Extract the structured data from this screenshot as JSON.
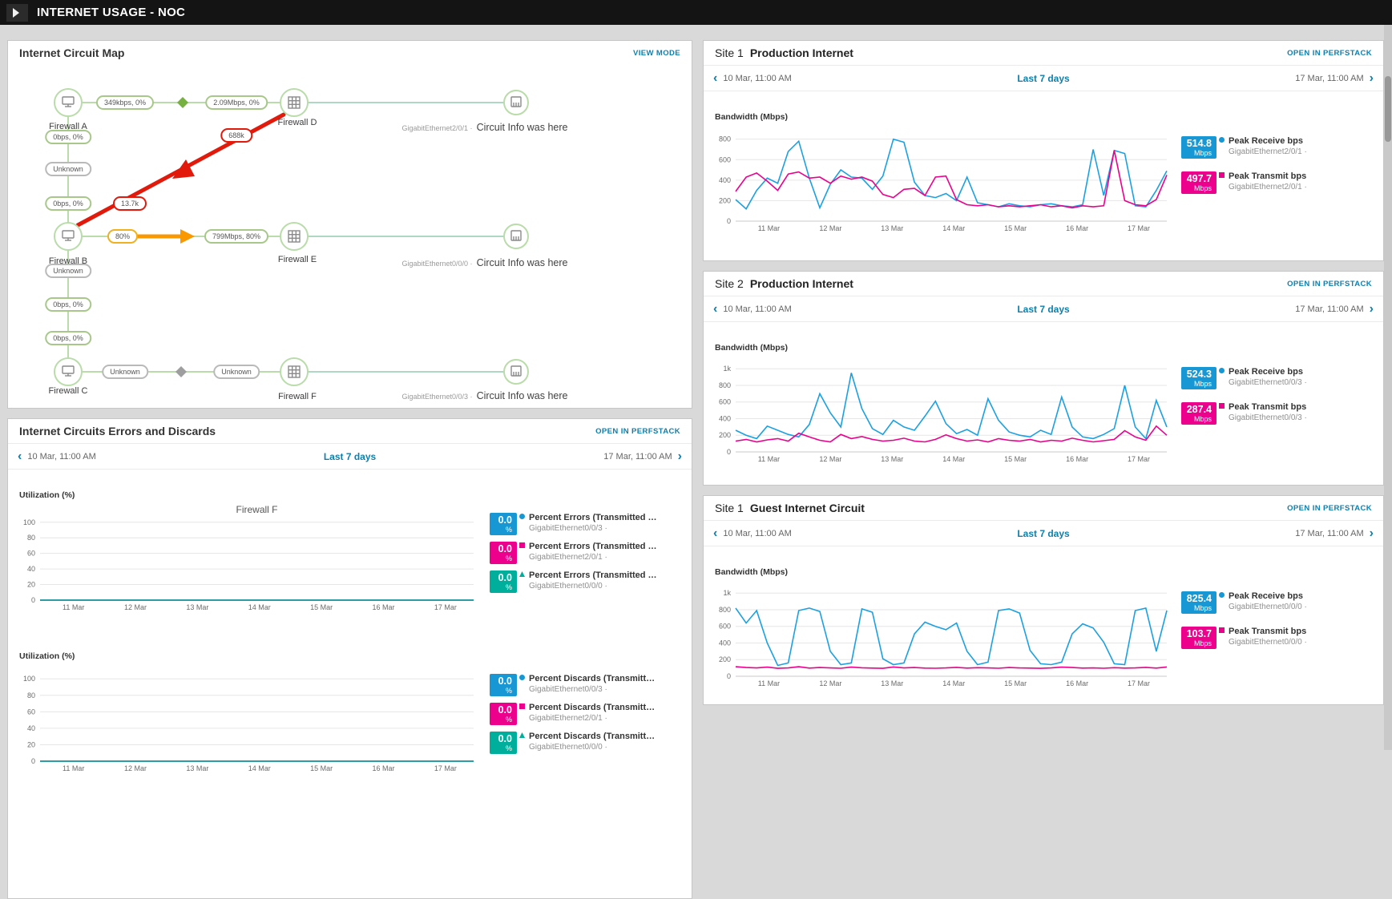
{
  "header": {
    "title": "INTERNET USAGE - NOC"
  },
  "icons": {
    "prev": "‹",
    "next": "›"
  },
  "timeframe": {
    "start": "10 Mar, 11:00 AM",
    "label": "Last 7 days",
    "end": "17 Mar, 11:00 AM"
  },
  "colors": {
    "link": "#0e7fae",
    "receive": "#1ba0e2",
    "transmit": "#ec008c",
    "teal_series": "#00af9b",
    "alert_red": "#e11a0c",
    "warn_yellow": "#f0b01f"
  },
  "circuit_map": {
    "title": "Internet Circuit Map",
    "view_mode": "VIEW MODE",
    "nodes": [
      {
        "label": "Firewall A"
      },
      {
        "label": "Firewall B"
      },
      {
        "label": "Firewall C"
      },
      {
        "label": "Firewall D"
      },
      {
        "label": "Firewall E"
      },
      {
        "label": "Firewall F"
      }
    ],
    "ports": [
      {
        "iface": "GigabitEthernet2/0/1 ·",
        "info": "Circuit Info was here"
      },
      {
        "iface": "GigabitEthernet0/0/0 ·",
        "info": "Circuit Info was here"
      },
      {
        "iface": "GigabitEthernet0/0/3 ·",
        "info": "Circuit Info was here"
      }
    ],
    "pills": [
      {
        "label": "349kbps, 0%"
      },
      {
        "label": "2.09Mbps, 0%"
      },
      {
        "label": "688k"
      },
      {
        "label": "0bps, 0%"
      },
      {
        "label": "Unknown"
      },
      {
        "label": "0bps, 0%"
      },
      {
        "label": "13.7k"
      },
      {
        "label": "80%"
      },
      {
        "label": "799Mbps, 80%"
      },
      {
        "label": "Unknown"
      },
      {
        "label": "0bps, 0%"
      },
      {
        "label": "0bps, 0%"
      },
      {
        "label": "Unknown"
      },
      {
        "label": "Unknown"
      }
    ]
  },
  "errors_panel": {
    "title": "Internet Circuits Errors and Discards",
    "open": "OPEN IN PERFSTACK",
    "sections": [
      {
        "axis": "Utilization (%)",
        "legend": [
          {
            "value": "0.0",
            "unit": "%",
            "color": "#1798d5",
            "title": "Percent Errors (Transmitted …",
            "sub": "GigabitEthernet0/0/3 ·"
          },
          {
            "value": "0.0",
            "unit": "%",
            "color": "#ec008c",
            "title": "Percent Errors (Transmitted …",
            "sub": "GigabitEthernet2/0/1 ·"
          },
          {
            "value": "0.0",
            "unit": "%",
            "color": "#00af9b",
            "title": "Percent Errors (Transmitted …",
            "sub": "GigabitEthernet0/0/0 ·"
          }
        ]
      },
      {
        "axis": "Utilization (%)",
        "legend": [
          {
            "value": "0.0",
            "unit": "%",
            "color": "#1798d5",
            "title": "Percent Discards (Transmitt…",
            "sub": "GigabitEthernet0/0/3 ·"
          },
          {
            "value": "0.0",
            "unit": "%",
            "color": "#ec008c",
            "title": "Percent Discards (Transmitt…",
            "sub": "GigabitEthernet2/0/1 ·"
          },
          {
            "value": "0.0",
            "unit": "%",
            "color": "#00af9b",
            "title": "Percent Discards (Transmitt…",
            "sub": "GigabitEthernet0/0/0 ·"
          }
        ]
      }
    ]
  },
  "right_panels": [
    {
      "site": "Site 1",
      "name": "Production Internet",
      "open": "OPEN IN PERFSTACK",
      "axis": "Bandwidth (Mbps)",
      "legend": [
        {
          "value": "514.8",
          "unit": "Mbps",
          "color": "#1798d5",
          "title": "Peak Receive bps",
          "sub": "GigabitEthernet2/0/1 ·"
        },
        {
          "value": "497.7",
          "unit": "Mbps",
          "color": "#ec008c",
          "title": "Peak Transmit bps",
          "sub": "GigabitEthernet2/0/1 ·"
        }
      ]
    },
    {
      "site": "Site 2",
      "name": "Production Internet",
      "open": "OPEN IN PERFSTACK",
      "axis": "Bandwidth (Mbps)",
      "legend": [
        {
          "value": "524.3",
          "unit": "Mbps",
          "color": "#1798d5",
          "title": "Peak Receive bps",
          "sub": "GigabitEthernet0/0/3 ·"
        },
        {
          "value": "287.4",
          "unit": "Mbps",
          "color": "#ec008c",
          "title": "Peak Transmit bps",
          "sub": "GigabitEthernet0/0/3 ·"
        }
      ]
    },
    {
      "site": "Site 1",
      "name": "Guest Internet Circuit",
      "open": "OPEN IN PERFSTACK",
      "axis": "Bandwidth (Mbps)",
      "legend": [
        {
          "value": "825.4",
          "unit": "Mbps",
          "color": "#1798d5",
          "title": "Peak Receive bps",
          "sub": "GigabitEthernet0/0/0 ·"
        },
        {
          "value": "103.7",
          "unit": "Mbps",
          "color": "#ec008c",
          "title": "Peak Transmit bps",
          "sub": "GigabitEthernet0/0/0 ·"
        }
      ]
    }
  ],
  "chart_data": {
    "site1_prod": {
      "type": "line",
      "title": "",
      "ylabel": "Bandwidth (Mbps)",
      "ymin": 0,
      "ymax": 860,
      "yticks": [
        {
          "v": 800,
          "label": "800"
        },
        {
          "v": 600,
          "label": "600"
        },
        {
          "v": 400,
          "label": "400"
        },
        {
          "v": 200,
          "label": "200"
        },
        {
          "v": 0,
          "label": "0"
        }
      ],
      "xticks": [
        {
          "f": 0.077,
          "label": "11 Mar"
        },
        {
          "f": 0.22,
          "label": "12 Mar"
        },
        {
          "f": 0.363,
          "label": "13 Mar"
        },
        {
          "f": 0.506,
          "label": "14 Mar"
        },
        {
          "f": 0.649,
          "label": "15 Mar"
        },
        {
          "f": 0.792,
          "label": "16 Mar"
        },
        {
          "f": 0.935,
          "label": "17 Mar"
        }
      ],
      "series": [
        {
          "name": "Peak Receive bps",
          "color": "#1ba0e2",
          "values": [
            210,
            120,
            300,
            420,
            370,
            680,
            780,
            420,
            130,
            360,
            500,
            430,
            420,
            310,
            440,
            800,
            770,
            380,
            250,
            230,
            270,
            200,
            430,
            180,
            160,
            140,
            170,
            150,
            140,
            160,
            170,
            150,
            140,
            160,
            700,
            250,
            690,
            660,
            150,
            140,
            300,
            490
          ]
        },
        {
          "name": "Peak Transmit bps",
          "color": "#ec008c",
          "values": [
            290,
            430,
            470,
            390,
            300,
            460,
            480,
            420,
            430,
            370,
            440,
            410,
            430,
            390,
            260,
            230,
            310,
            320,
            250,
            430,
            440,
            210,
            160,
            150,
            160,
            140,
            150,
            140,
            150,
            160,
            140,
            150,
            130,
            150,
            140,
            150,
            690,
            200,
            160,
            150,
            210,
            450
          ]
        }
      ]
    },
    "site2_prod": {
      "type": "line",
      "title": "",
      "ylabel": "Bandwidth (Mbps)",
      "ymin": 0,
      "ymax": 1060,
      "yticks": [
        {
          "v": 1000,
          "label": "1k"
        },
        {
          "v": 800,
          "label": "800"
        },
        {
          "v": 600,
          "label": "600"
        },
        {
          "v": 400,
          "label": "400"
        },
        {
          "v": 200,
          "label": "200"
        },
        {
          "v": 0,
          "label": "0"
        }
      ],
      "xticks": [
        {
          "f": 0.077,
          "label": "11 Mar"
        },
        {
          "f": 0.22,
          "label": "12 Mar"
        },
        {
          "f": 0.363,
          "label": "13 Mar"
        },
        {
          "f": 0.506,
          "label": "14 Mar"
        },
        {
          "f": 0.649,
          "label": "15 Mar"
        },
        {
          "f": 0.792,
          "label": "16 Mar"
        },
        {
          "f": 0.935,
          "label": "17 Mar"
        }
      ],
      "series": [
        {
          "name": "Peak Receive bps",
          "color": "#1ba0e2",
          "values": [
            260,
            200,
            160,
            310,
            260,
            210,
            180,
            330,
            700,
            470,
            300,
            950,
            520,
            280,
            210,
            380,
            300,
            260,
            430,
            610,
            340,
            220,
            270,
            200,
            640,
            380,
            240,
            200,
            180,
            260,
            210,
            660,
            300,
            180,
            160,
            210,
            280,
            800,
            300,
            160,
            620,
            300
          ]
        },
        {
          "name": "Peak Transmit bps",
          "color": "#ec008c",
          "values": [
            130,
            150,
            120,
            145,
            160,
            130,
            225,
            180,
            140,
            120,
            210,
            160,
            185,
            150,
            130,
            140,
            165,
            130,
            120,
            150,
            205,
            160,
            130,
            145,
            120,
            160,
            140,
            130,
            150,
            120,
            140,
            130,
            165,
            140,
            120,
            135,
            150,
            255,
            180,
            140,
            310,
            200
          ]
        }
      ]
    },
    "guest": {
      "type": "line",
      "title": "",
      "ylabel": "Bandwidth (Mbps)",
      "ymin": 0,
      "ymax": 1060,
      "yticks": [
        {
          "v": 1000,
          "label": "1k"
        },
        {
          "v": 800,
          "label": "800"
        },
        {
          "v": 600,
          "label": "600"
        },
        {
          "v": 400,
          "label": "400"
        },
        {
          "v": 200,
          "label": "200"
        },
        {
          "v": 0,
          "label": "0"
        }
      ],
      "xticks": [
        {
          "f": 0.077,
          "label": "11 Mar"
        },
        {
          "f": 0.22,
          "label": "12 Mar"
        },
        {
          "f": 0.363,
          "label": "13 Mar"
        },
        {
          "f": 0.506,
          "label": "14 Mar"
        },
        {
          "f": 0.649,
          "label": "15 Mar"
        },
        {
          "f": 0.792,
          "label": "16 Mar"
        },
        {
          "f": 0.935,
          "label": "17 Mar"
        }
      ],
      "series": [
        {
          "name": "Peak Receive bps",
          "color": "#1ba0e2",
          "values": [
            820,
            640,
            790,
            400,
            130,
            160,
            790,
            820,
            780,
            300,
            140,
            160,
            810,
            770,
            210,
            140,
            160,
            510,
            650,
            600,
            560,
            640,
            300,
            140,
            170,
            790,
            810,
            760,
            310,
            150,
            140,
            170,
            510,
            630,
            580,
            410,
            150,
            140,
            790,
            820,
            300,
            790
          ]
        },
        {
          "name": "Peak Transmit bps",
          "color": "#ec008c",
          "values": [
            115,
            105,
            100,
            110,
            95,
            100,
            115,
            98,
            105,
            100,
            96,
            110,
            102,
            98,
            95,
            112,
            100,
            105,
            98,
            96,
            100,
            107,
            98,
            103,
            100,
            96,
            105,
            100,
            98,
            95,
            100,
            110,
            105,
            98,
            100,
            96,
            103,
            98,
            100,
            107,
            98,
            112
          ]
        }
      ]
    },
    "errors": {
      "type": "line",
      "title": "Firewall F",
      "ylabel": "Utilization (%)",
      "ymin": 0,
      "ymax": 108,
      "yticks": [
        {
          "v": 100,
          "label": "100"
        },
        {
          "v": 80,
          "label": "80"
        },
        {
          "v": 60,
          "label": "60"
        },
        {
          "v": 40,
          "label": "40"
        },
        {
          "v": 20,
          "label": "20"
        },
        {
          "v": 0,
          "label": "0"
        }
      ],
      "xticks": [
        {
          "f": 0.077,
          "label": "11 Mar"
        },
        {
          "f": 0.22,
          "label": "12 Mar"
        },
        {
          "f": 0.363,
          "label": "13 Mar"
        },
        {
          "f": 0.506,
          "label": "14 Mar"
        },
        {
          "f": 0.649,
          "label": "15 Mar"
        },
        {
          "f": 0.792,
          "label": "16 Mar"
        },
        {
          "f": 0.935,
          "label": "17 Mar"
        }
      ],
      "series": [
        {
          "name": "Percent Errors GigabitEthernet0/0/3",
          "color": "#1798d5",
          "values": [
            0,
            0,
            0,
            0,
            0,
            0,
            0,
            0
          ]
        },
        {
          "name": "Percent Errors GigabitEthernet2/0/1",
          "color": "#ec008c",
          "values": [
            0,
            0,
            0,
            0,
            0,
            0,
            0,
            0
          ]
        },
        {
          "name": "Percent Errors GigabitEthernet0/0/0",
          "color": "#00af9b",
          "values": [
            0,
            0,
            0,
            0,
            0,
            0,
            0,
            0
          ]
        }
      ]
    },
    "discards": {
      "type": "line",
      "title": "",
      "ylabel": "Utilization (%)",
      "ymin": 0,
      "ymax": 108,
      "yticks": [
        {
          "v": 100,
          "label": "100"
        },
        {
          "v": 80,
          "label": "80"
        },
        {
          "v": 60,
          "label": "60"
        },
        {
          "v": 40,
          "label": "40"
        },
        {
          "v": 20,
          "label": "20"
        },
        {
          "v": 0,
          "label": "0"
        }
      ],
      "xticks": [
        {
          "f": 0.077,
          "label": "11 Mar"
        },
        {
          "f": 0.22,
          "label": "12 Mar"
        },
        {
          "f": 0.363,
          "label": "13 Mar"
        },
        {
          "f": 0.506,
          "label": "14 Mar"
        },
        {
          "f": 0.649,
          "label": "15 Mar"
        },
        {
          "f": 0.792,
          "label": "16 Mar"
        },
        {
          "f": 0.935,
          "label": "17 Mar"
        }
      ],
      "series": [
        {
          "name": "Percent Discards GigabitEthernet0/0/3",
          "color": "#1798d5",
          "values": [
            0,
            0,
            0,
            0,
            0,
            0,
            0,
            0
          ]
        },
        {
          "name": "Percent Discards GigabitEthernet2/0/1",
          "color": "#ec008c",
          "values": [
            0,
            0,
            0,
            0,
            0,
            0,
            0,
            0
          ]
        },
        {
          "name": "Percent Discards GigabitEthernet0/0/0",
          "color": "#00af9b",
          "values": [
            0,
            0,
            0,
            0,
            0,
            0,
            0,
            0
          ]
        }
      ]
    }
  }
}
